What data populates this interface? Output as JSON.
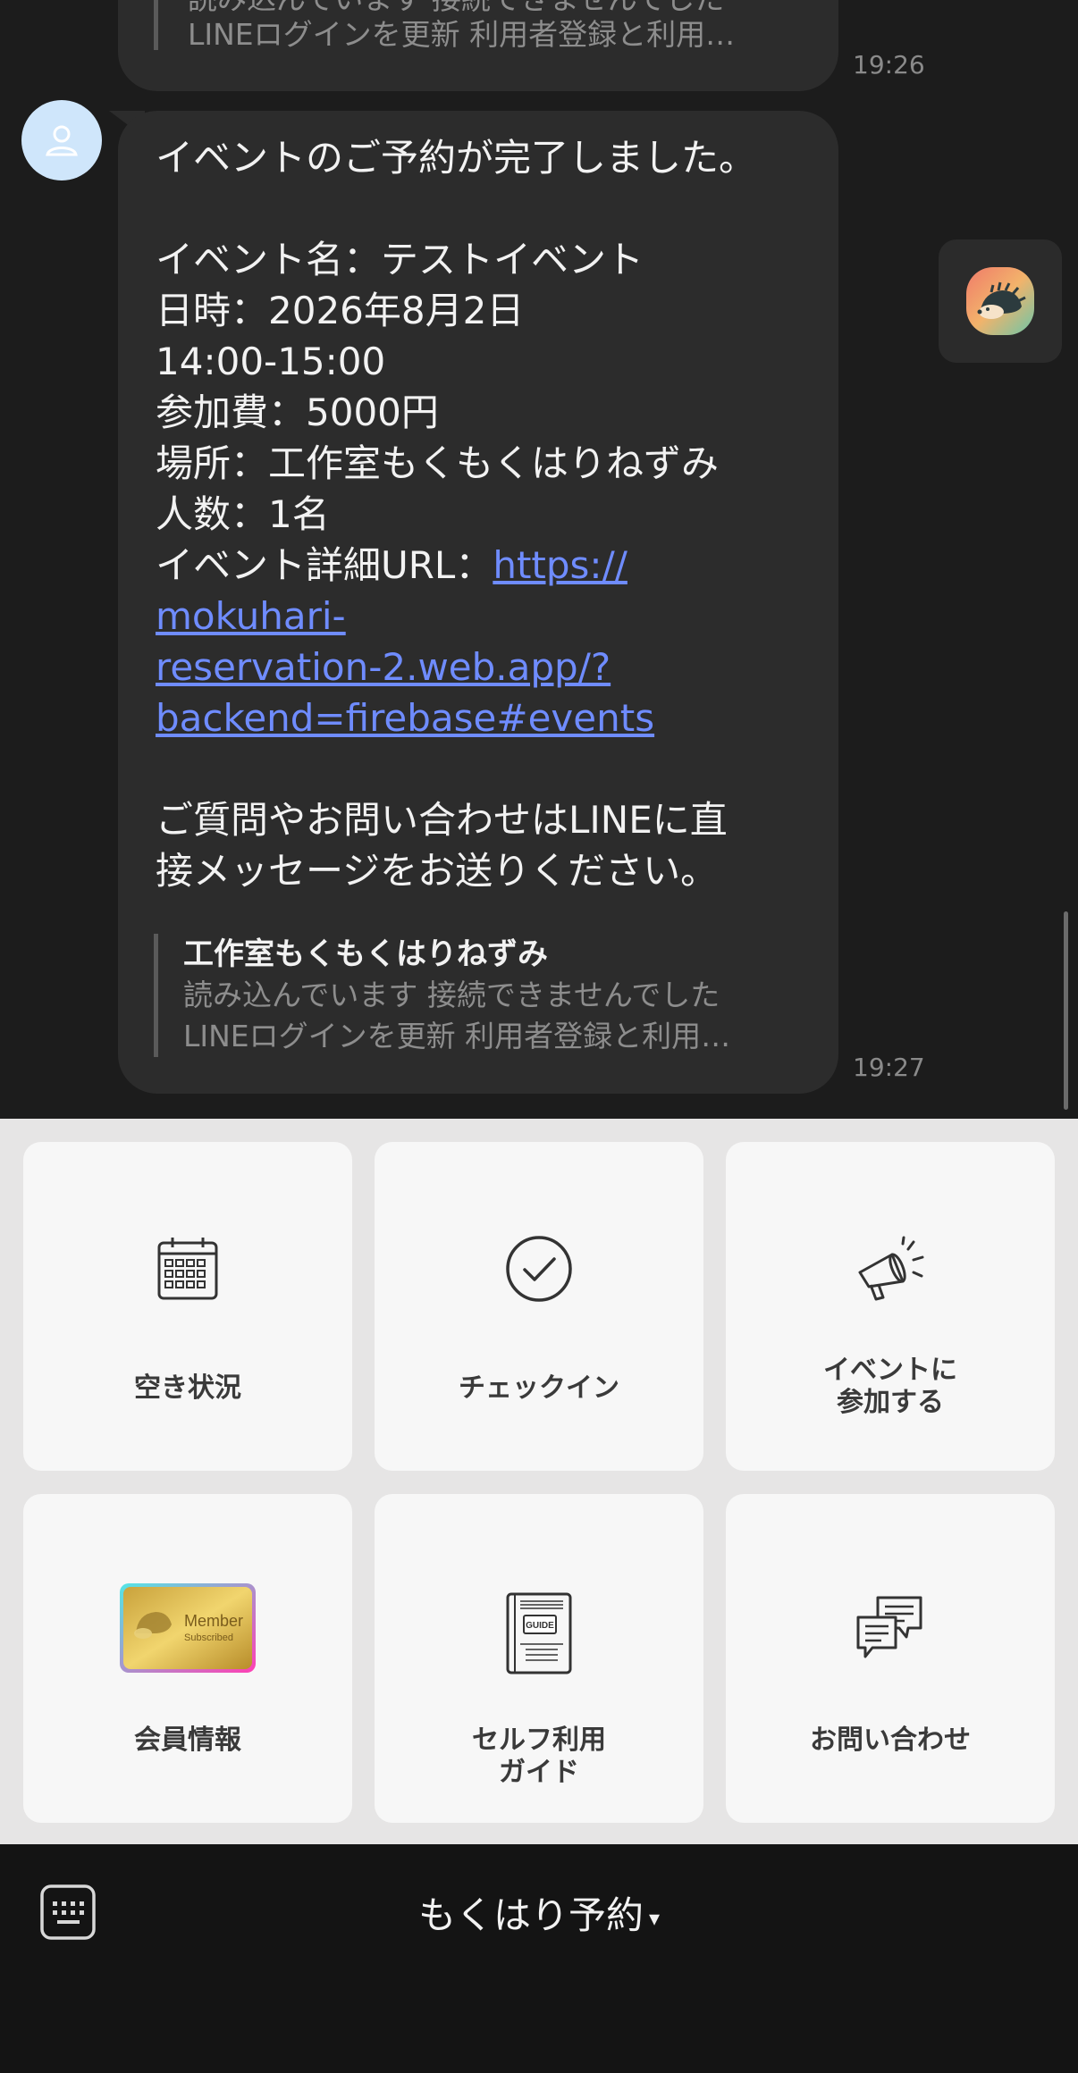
{
  "chat": {
    "previous": {
      "preview_line1": "読み込んでいます 接続できませんでした",
      "preview_line2": "LINEログインを更新 利用者登録と利用…",
      "time": "19:26"
    },
    "message": {
      "line_intro": "イベントのご予約が完了しました。",
      "line_name": "イベント名：テストイベント",
      "line_date": "日時：2026年8月2日",
      "line_time": "14:00-15:00",
      "line_fee": "参加費：5000円",
      "line_place": "場所：工作室もくもくはりねずみ",
      "line_people": "人数：1名",
      "url_label": "イベント詳細URL：",
      "url": "https://mokuhari-reservation-2.web.app/?backend=firebase#events",
      "url_part1": "https://",
      "url_part2": "mokuhari-",
      "url_part3": "reservation-2.web.app/?",
      "url_part4": "backend=firebase#events",
      "closing_line1": "ご質問やお問い合わせはLINEに直",
      "closing_line2": "接メッセージをお送りください。"
    },
    "link_preview": {
      "title": "工作室もくもくはりねずみ",
      "desc_line1": "読み込んでいます 接続できませんでした",
      "desc_line2": "LINEログインを更新 利用者登録と利用…"
    },
    "time": "19:27"
  },
  "rich_menu": {
    "tiles": [
      {
        "label": "空き状況",
        "icon": "calendar-icon"
      },
      {
        "label": "チェックイン",
        "icon": "check-circle-icon"
      },
      {
        "label": "イベントに\n参加する",
        "icon": "megaphone-icon"
      },
      {
        "label": "会員情報",
        "icon": "member-card-icon",
        "card_text_1": "Member",
        "card_text_2": "Subscribed"
      },
      {
        "label": "セルフ利用\nガイド",
        "icon": "guide-book-icon",
        "book_text": "GUIDE"
      },
      {
        "label": "お問い合わせ",
        "icon": "chat-bubbles-icon"
      }
    ]
  },
  "bottom_bar": {
    "menu_title": "もくはり予約",
    "caret": "▾"
  },
  "colors": {
    "chat_bg": "#1c1c1c",
    "bubble": "#2c2c2c",
    "link": "#6f8cff",
    "menu_bg": "#e6e5e5",
    "tile_bg": "#f7f7f7",
    "bottom_bar": "#141414"
  }
}
